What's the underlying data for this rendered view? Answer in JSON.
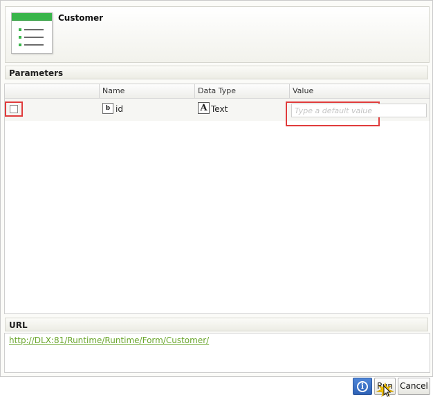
{
  "header": {
    "title": "Customer",
    "icon": "form-icon"
  },
  "parameters": {
    "section_title": "Parameters",
    "columns": [
      "",
      "Name",
      "Data Type",
      "Value"
    ],
    "rows": [
      {
        "checked": false,
        "name": "id",
        "name_icon": "parameter-icon",
        "data_type": "Text",
        "data_type_icon": "text-type-icon",
        "value": "",
        "value_placeholder": "Type a default value"
      }
    ]
  },
  "url": {
    "section_title": "URL",
    "link": "http://DLX:81/Runtime/Runtime/Form/Customer/"
  },
  "buttons": {
    "info": "i",
    "run": "Run",
    "cancel": "Cancel"
  },
  "colors": {
    "highlight": "#e03b3b",
    "link": "#6aa62c",
    "form_bar": "#39b54a",
    "info_button": "#3a70c8"
  }
}
